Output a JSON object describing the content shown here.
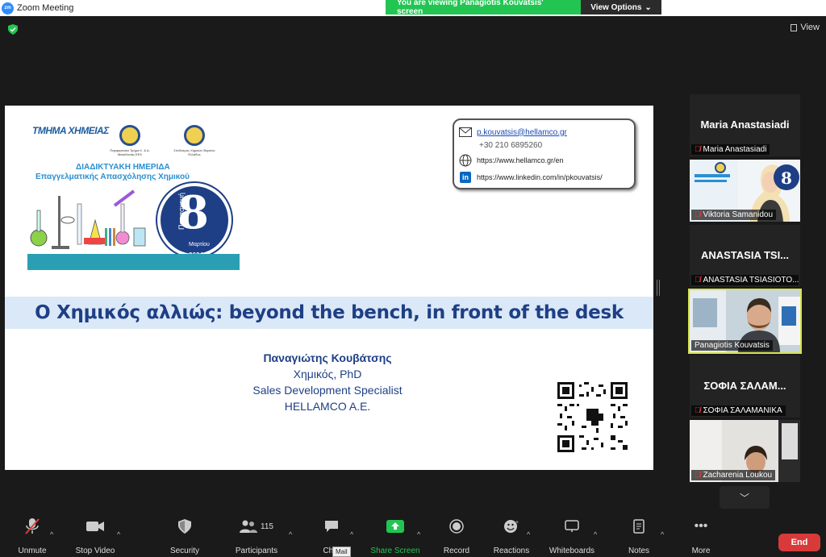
{
  "window": {
    "title": "Zoom Meeting"
  },
  "share_banner": {
    "text": "You are viewing Panagiotis Kouvatsis' screen",
    "options_label": "View Options"
  },
  "view_button": {
    "label": "View"
  },
  "slide": {
    "event": {
      "department": "ΤΜΗΜΑ ΧΗΜΕΙΑΣ",
      "seal1_caption": "Περιφερειακό Τμήμα Κ. & Δ. Μακεδονίας ΕΕΧ",
      "seal2_caption": "Σύνδεσμος Χημικών Βορείου Ελλάδος",
      "line1": "ΔΙΑΔΙΚΤΥΑΚΗ ΗΜΕΡΙΔΑ",
      "line2": "Επαγγελματικής Απασχόλησης Χημικού",
      "day_name": "Παρασκευή",
      "day_number": "8",
      "month": "Μαρτίου",
      "year": "2024"
    },
    "contact": {
      "email": "p.kouvatsis@hellamco.gr",
      "phone": "+30 210 6895260",
      "website": "https://www.hellamco.gr/en",
      "linkedin": "https://www.linkedin.com/in/pkouvatsis/"
    },
    "headline": "Ο Χημικός αλλιώς: beyond the bench, in front of the desk",
    "presenter": {
      "name": "Παναγιώτης Κουβάτσης",
      "title": "Χημικός, PhD",
      "role": "Sales Development Specialist",
      "company": "HELLAMCO A.E."
    }
  },
  "participants": [
    {
      "display": "Maria Anastasiadi",
      "label": "Maria Anastasiadi",
      "muted": true,
      "video": false
    },
    {
      "display": "",
      "label": "Viktoria Samanidou",
      "muted": true,
      "video": true
    },
    {
      "display": "ANASTASIA TSI...",
      "label": "ANASTASIA TSIASIOTO...",
      "muted": true,
      "video": false
    },
    {
      "display": "",
      "label": "Panagiotis Kouvatsis",
      "muted": false,
      "video": true,
      "active": true
    },
    {
      "display": "ΣΟΦΙΑ ΣΑΛΑΜ...",
      "label": "ΣΟΦΙΑ ΣΑΛΑΜΑΝΙΚΑ",
      "muted": true,
      "video": false
    },
    {
      "display": "",
      "label": "Zacharenia Loukou",
      "muted": true,
      "video": true
    }
  ],
  "toolbar": {
    "unmute": "Unmute",
    "stop_video": "Stop Video",
    "security": "Security",
    "participants": "Participants",
    "participants_count": "115",
    "chat": "Chat",
    "share_screen": "Share Screen",
    "record": "Record",
    "reactions": "Reactions",
    "whiteboards": "Whiteboards",
    "notes": "Notes",
    "more": "More",
    "end": "End",
    "tooltip": "Mail"
  },
  "colors": {
    "accent": "#23c552",
    "end": "#d83a3a",
    "slide_blue": "#1e3f86",
    "active_border": "#d7e34a"
  }
}
